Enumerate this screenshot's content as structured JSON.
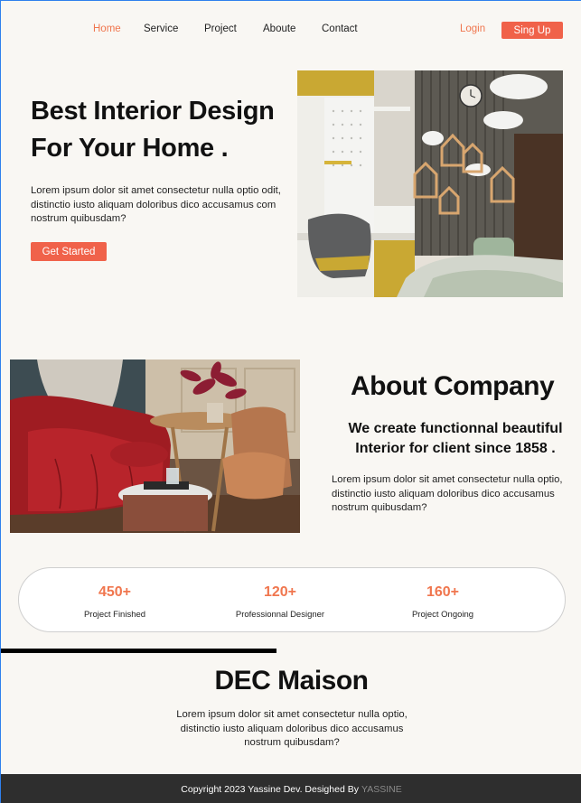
{
  "nav": {
    "items": [
      "Home",
      "Service",
      "Project",
      "Aboute",
      "Contact"
    ],
    "login": "Login",
    "signup": "Sing Up"
  },
  "hero": {
    "title_line1": "Best Interior Design",
    "title_line2": "For Your Home .",
    "text": "Lorem ipsum dolor sit amet consectetur  nulla optio odit, distinctio iusto aliquam doloribus dico accusamus com nostrum quibusdam?",
    "button": "Get Started"
  },
  "about": {
    "title": "About Company",
    "subtitle": "We create functionnal beautiful Interior for client since 1858 .",
    "text": "Lorem ipsum dolor sit amet consectetur  nulla optio, distinctio iusto aliquam doloribus dico accusamus nostrum quibusdam?"
  },
  "stats": [
    {
      "value": "450+",
      "label": "Project Finished"
    },
    {
      "value": "120+",
      "label": "Professionnal Designer"
    },
    {
      "value": "160+",
      "label": "Project  Ongoing"
    }
  ],
  "dec": {
    "title": "DEC Maison",
    "text": "Lorem ipsum dolor sit amet consectetur  nulla optio, distinctio iusto aliquam doloribus dico accusamus nostrum quibusdam?"
  },
  "footer": {
    "text": "Copyright 2023 Yassine Dev. Desighed By",
    "brand": "YASSINE"
  },
  "colors": {
    "accent": "#f0764e",
    "button": "#f0624a",
    "background": "#f9f7f3",
    "footer": "#2e2e2e"
  }
}
